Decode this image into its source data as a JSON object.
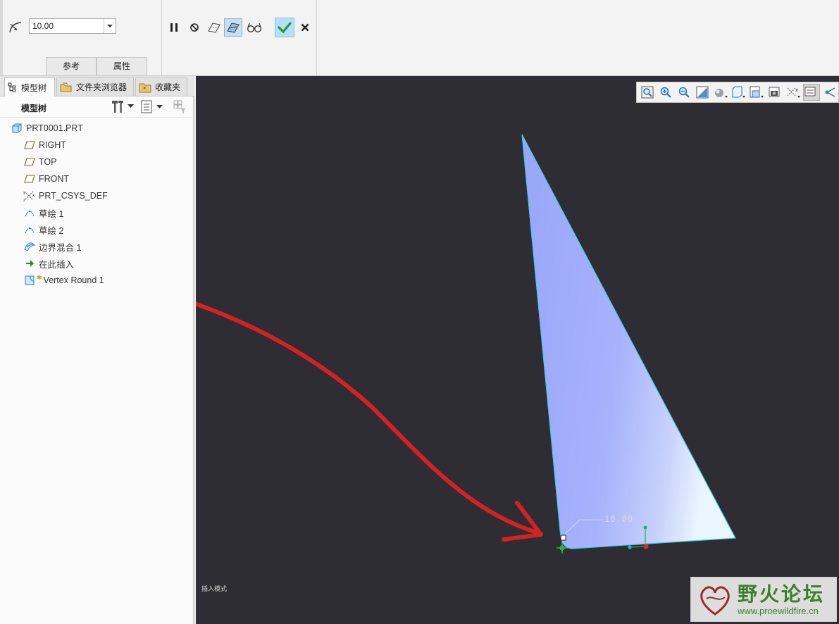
{
  "dashboard": {
    "radius_value": "10.00",
    "tabs": [
      "参考",
      "属性"
    ]
  },
  "navigator": {
    "tabs": [
      "模型树",
      "文件夹浏览器",
      "收藏夹"
    ],
    "tree_title": "模型树",
    "items": [
      {
        "label": "PRT0001.PRT",
        "icon": "part-icon"
      },
      {
        "label": "RIGHT",
        "icon": "datum-plane-icon"
      },
      {
        "label": "TOP",
        "icon": "datum-plane-icon"
      },
      {
        "label": "FRONT",
        "icon": "datum-plane-icon"
      },
      {
        "label": "PRT_CSYS_DEF",
        "icon": "csys-icon"
      },
      {
        "label": "草绘 1",
        "icon": "sketch-icon"
      },
      {
        "label": "草绘 2",
        "icon": "sketch-icon"
      },
      {
        "label": "边界混合 1",
        "icon": "boundary-blend-icon"
      },
      {
        "label": "在此插入",
        "icon": "insert-here-arrow-icon"
      },
      {
        "label": "Vertex Round 1",
        "icon": "vertex-round-icon"
      }
    ]
  },
  "graphics": {
    "dimension_label": "10.00",
    "status_text": "插入模式"
  },
  "watermark": {
    "name": "野火论坛",
    "url": "www.proewildfire.cn"
  },
  "colors": {
    "background": "#2e2d33",
    "surface": "#a9b6ff",
    "edge": "#43c8e8",
    "annotation_arrow": "#d42222",
    "ok_check": "#1e9b3a"
  }
}
